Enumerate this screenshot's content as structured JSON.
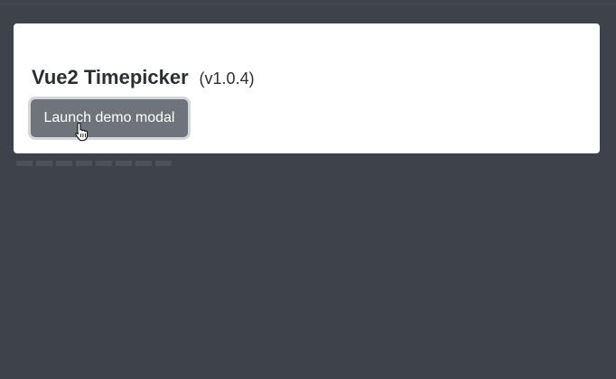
{
  "header": {
    "title": "Vue2 Timepicker",
    "version": "(v1.0.4)"
  },
  "actions": {
    "launch_label": "Launch demo modal"
  },
  "colors": {
    "page_background": "#3e434a",
    "card_background": "#ffffff",
    "button_background": "#6f747b",
    "button_focus_ring": "#d3d6da",
    "title_text": "#2b2f33"
  },
  "icons": {
    "cursor": "hand-pointer-icon"
  }
}
